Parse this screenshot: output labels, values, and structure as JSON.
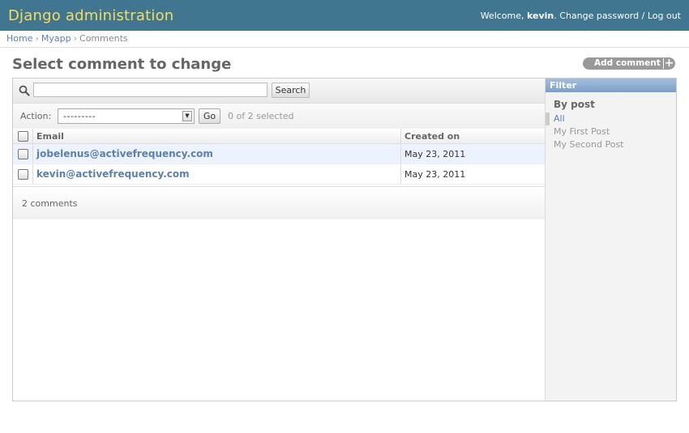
{
  "header": {
    "site_title": "Django administration",
    "welcome": "Welcome, ",
    "username": "kevin",
    "change_password": "Change password",
    "separator": " / ",
    "logout": "Log out"
  },
  "breadcrumbs": {
    "home": "Home",
    "app": "Myapp",
    "current": "Comments",
    "sep": "›"
  },
  "page": {
    "title": "Select comment to change",
    "add_button": "Add comment",
    "add_icon": "+"
  },
  "search": {
    "value": "",
    "button": "Search"
  },
  "actions": {
    "label": "Action:",
    "selected_option": "---------",
    "go": "Go",
    "counter": "0 of 2 selected"
  },
  "table": {
    "columns": [
      "Email",
      "Created on"
    ],
    "rows": [
      {
        "email": "jobelenus@activefrequency.com",
        "created": "May 23, 2011"
      },
      {
        "email": "kevin@activefrequency.com",
        "created": "May 23, 2011"
      }
    ]
  },
  "paginator": "2 comments",
  "filter": {
    "heading": "Filter",
    "subheading": "By post",
    "options": [
      "All",
      "My First Post",
      "My Second Post"
    ],
    "selected": "All"
  },
  "colors": {
    "header_bg": "#417690",
    "title_yellow": "#f5dd5d",
    "link": "#5b80b2",
    "filter_head": "#7ca0c7"
  }
}
